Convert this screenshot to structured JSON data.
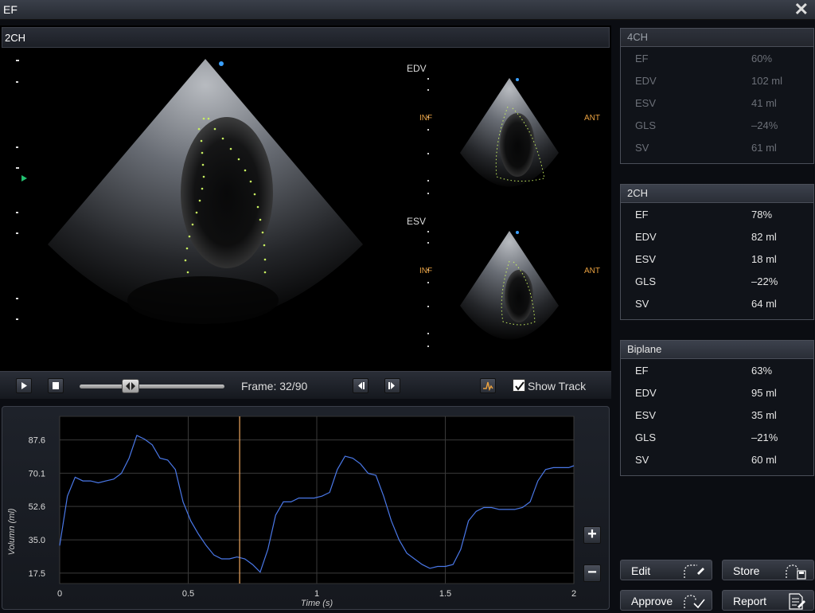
{
  "window": {
    "title": "EF"
  },
  "viewer": {
    "view_label": "2CH",
    "edv_label": "EDV",
    "esv_label": "ESV",
    "inf_label": "INF",
    "ant_label": "ANT"
  },
  "playback": {
    "frame_text": "Frame: 32/90",
    "show_track_label": "Show Track",
    "show_track_checked": true,
    "position_fraction": 0.35
  },
  "chart_data": {
    "type": "line",
    "xlabel": "Time (s)",
    "ylabel": "Volumn (ml)",
    "xlim": [
      0,
      2
    ],
    "ylim": [
      12,
      100
    ],
    "x_ticks": [
      "0",
      "0.5",
      "1",
      "1.5",
      "2"
    ],
    "y_ticks": [
      "17.5",
      "35.0",
      "52.6",
      "70.1",
      "87.6"
    ],
    "cursor_time": 0.7,
    "series": [
      {
        "color": "#4a78e8",
        "x": [
          0,
          0.03,
          0.06,
          0.09,
          0.12,
          0.15,
          0.18,
          0.21,
          0.24,
          0.27,
          0.3,
          0.33,
          0.36,
          0.39,
          0.42,
          0.45,
          0.48,
          0.51,
          0.54,
          0.57,
          0.6,
          0.63,
          0.66,
          0.69,
          0.72,
          0.75,
          0.78,
          0.81,
          0.84,
          0.87,
          0.9,
          0.93,
          0.96,
          0.99,
          1.02,
          1.05,
          1.08,
          1.11,
          1.14,
          1.17,
          1.2,
          1.23,
          1.26,
          1.29,
          1.32,
          1.35,
          1.38,
          1.41,
          1.44,
          1.47,
          1.5,
          1.53,
          1.56,
          1.59,
          1.62,
          1.65,
          1.68,
          1.71,
          1.74,
          1.77,
          1.8,
          1.83,
          1.86,
          1.89,
          1.92,
          1.95,
          1.98,
          2.0
        ],
        "y": [
          32,
          58,
          68,
          66,
          66,
          65,
          66,
          67,
          70,
          78,
          90,
          88,
          85,
          78,
          77,
          72,
          55,
          45,
          38,
          32,
          27,
          25,
          25,
          26,
          25,
          22,
          18,
          30,
          48,
          55,
          55,
          57,
          57,
          57,
          58,
          60,
          72,
          79,
          78,
          75,
          70,
          69,
          58,
          45,
          35,
          28,
          25,
          22,
          20,
          21,
          21,
          22,
          30,
          45,
          50,
          52,
          52,
          51,
          51,
          51,
          52,
          55,
          66,
          72,
          73,
          73,
          73,
          74
        ]
      }
    ]
  },
  "cards": [
    {
      "title": "4CH",
      "dim": true,
      "rows": [
        {
          "label": "EF",
          "value": "60%"
        },
        {
          "label": "EDV",
          "value": "102 ml"
        },
        {
          "label": "ESV",
          "value": "41 ml"
        },
        {
          "label": "GLS",
          "value": "–24%"
        },
        {
          "label": "SV",
          "value": "61 ml"
        }
      ]
    },
    {
      "title": "2CH",
      "dim": false,
      "rows": [
        {
          "label": "EF",
          "value": "78%"
        },
        {
          "label": "EDV",
          "value": "82 ml"
        },
        {
          "label": "ESV",
          "value": "18 ml"
        },
        {
          "label": "GLS",
          "value": "–22%"
        },
        {
          "label": "SV",
          "value": "64 ml"
        }
      ]
    },
    {
      "title": "Biplane",
      "dim": false,
      "rows": [
        {
          "label": "EF",
          "value": "63%"
        },
        {
          "label": "EDV",
          "value": "95 ml"
        },
        {
          "label": "ESV",
          "value": "35 ml"
        },
        {
          "label": "GLS",
          "value": "–21%"
        },
        {
          "label": "SV",
          "value": "60 ml"
        }
      ]
    }
  ],
  "actions": {
    "edit": "Edit",
    "store": "Store",
    "approve": "Approve",
    "report": "Report"
  }
}
